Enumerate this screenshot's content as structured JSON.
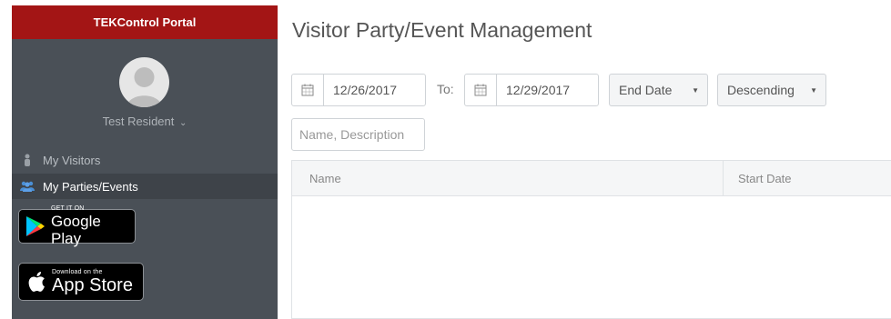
{
  "sidebar": {
    "brand": "TEKControl Portal",
    "user_name": "Test Resident",
    "nav": [
      {
        "label": "My Visitors",
        "icon": "person-icon",
        "active": false
      },
      {
        "label": "My Parties/Events",
        "icon": "group-icon",
        "active": true
      }
    ],
    "google_play": {
      "small": "GET IT ON",
      "big": "Google Play"
    },
    "app_store": {
      "small": "Download on the",
      "big": "App Store"
    }
  },
  "main": {
    "title": "Visitor Party/Event Management",
    "from_date": "12/26/2017",
    "to_label": "To:",
    "to_date": "12/29/2017",
    "sort_field": "End Date",
    "sort_order": "Descending",
    "search_placeholder": "Name, Description",
    "grid": {
      "columns": [
        "Name",
        "Start Date"
      ]
    }
  },
  "colors": {
    "brand_red": "#a31515",
    "sidebar_bg": "#4a5057"
  }
}
